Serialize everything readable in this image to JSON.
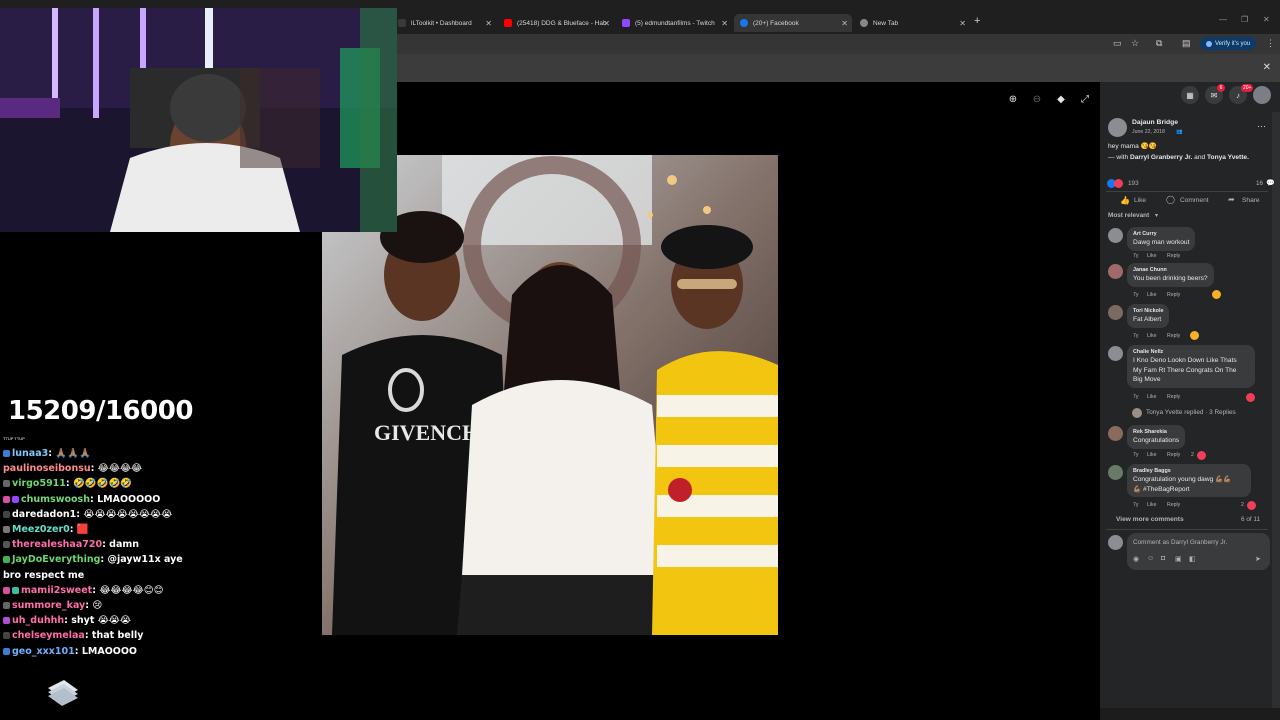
{
  "browser": {
    "tabs": [
      {
        "label": "lLToolkit • Dashboard",
        "fav_color": "#3a3a3a"
      },
      {
        "label": "(25418) DDG & Blueface - Hab",
        "fav_color": "#ff0000"
      },
      {
        "label": "(5) edmundtanfilms - Twitch",
        "fav_color": "#9146ff"
      },
      {
        "label": "(20+) Facebook",
        "fav_color": "#1877f2"
      },
      {
        "label": "New Tab",
        "fav_color": "#888888"
      }
    ],
    "new_tab_glyph": "+",
    "verify_label": "Verify it's you"
  },
  "stream": {
    "counter": "15209/16000",
    "tiny_label": "TTUP TTUP",
    "chat": [
      {
        "user": "lunaa3",
        "color": "#7ec8ff",
        "msg": "🙏🏽🙏🏽🙏🏽"
      },
      {
        "user": "paulinoseibonsu",
        "color": "#ff8c8c",
        "msg": "😂😂😂😂"
      },
      {
        "user": "virgo5911",
        "color": "#6dd66d",
        "msg": "🤣🤣🤣🤣🤣"
      },
      {
        "user": "chumswoosh",
        "color": "#7ad67a",
        "msg": "LMAOOOOO"
      },
      {
        "user": "daredadon1",
        "color": "#ffffff",
        "msg": "😭😭😭😭😭😭😭😭"
      },
      {
        "user": "Meez0zer0",
        "color": "#66e0c8",
        "msg": "🟥"
      },
      {
        "user": "therealeshaa720",
        "color": "#ff6ea8",
        "msg": "damn"
      },
      {
        "user": "JayDoEverything",
        "color": "#6dd66d",
        "msg": "@jayw11x aye bro respect me"
      },
      {
        "user": "mamii2sweet",
        "color": "#ff6ea8",
        "msg": "😂😂😂😂😊😊"
      },
      {
        "user": "summore_kay",
        "color": "#ff6ea8",
        "msg": "😢"
      },
      {
        "user": "uh_duhhh",
        "color": "#ff6ea8",
        "msg": "shyt 😭😭😭"
      },
      {
        "user": "chelseymelaa",
        "color": "#ff6ea8",
        "msg": "that belly"
      },
      {
        "user": "geo_xxx101",
        "color": "#6fb0ff",
        "msg": "LMAOOOO"
      }
    ]
  },
  "facebook": {
    "badges": {
      "messenger": "6",
      "notifications": "20+"
    },
    "post": {
      "author": "Dajaun Bridge",
      "date": "June 22, 2018",
      "text": "hey mama 😘😘",
      "with_prefix": "— with",
      "tag1": "Darryl Granberry Jr.",
      "and": "and",
      "tag2": "Tonya Yvette.",
      "reactions": "193",
      "comment_count": "16"
    },
    "actions": {
      "like": "Like",
      "comment": "Comment",
      "share": "Share"
    },
    "sort_label": "Most relevant",
    "comments": [
      {
        "name": "Art Curry",
        "lines": [
          "Dawg man workout"
        ],
        "age": "7y",
        "like": "Like",
        "reply": "Reply"
      },
      {
        "name": "Janae Chunn",
        "lines": [
          "You been drinking beers?"
        ],
        "age": "7y",
        "like": "Like",
        "reply": "Reply"
      },
      {
        "name": "Tori Nickole",
        "lines": [
          "Fat Albert"
        ],
        "age": "7y",
        "like": "Like",
        "reply": "Reply"
      },
      {
        "name": "Chalie Nellz",
        "lines": [
          "I Kno Deno Lookn Down Like Thats",
          "My Fam Rt There Congrats On The",
          "Big Move"
        ],
        "age": "7y",
        "like": "Like",
        "reply": "Reply"
      },
      {
        "name": "Rek Sharekia",
        "lines": [
          "Congratulations"
        ],
        "age": "7y",
        "like": "Like",
        "reply": "Reply",
        "count": "2"
      },
      {
        "name": "Bradley Baggs",
        "lines": [
          "Congratulation young dawg 💪🏽💪🏽",
          "💪🏽 #TheBagReport"
        ],
        "age": "7y",
        "like": "Like",
        "reply": "Reply",
        "count": "2"
      }
    ],
    "replied_label": "Tonya Yvette replied · 3 Replies",
    "view_more": "View more comments",
    "pagination": "6 of 11",
    "comment_placeholder": "Comment as Darryl Granberry Jr."
  }
}
